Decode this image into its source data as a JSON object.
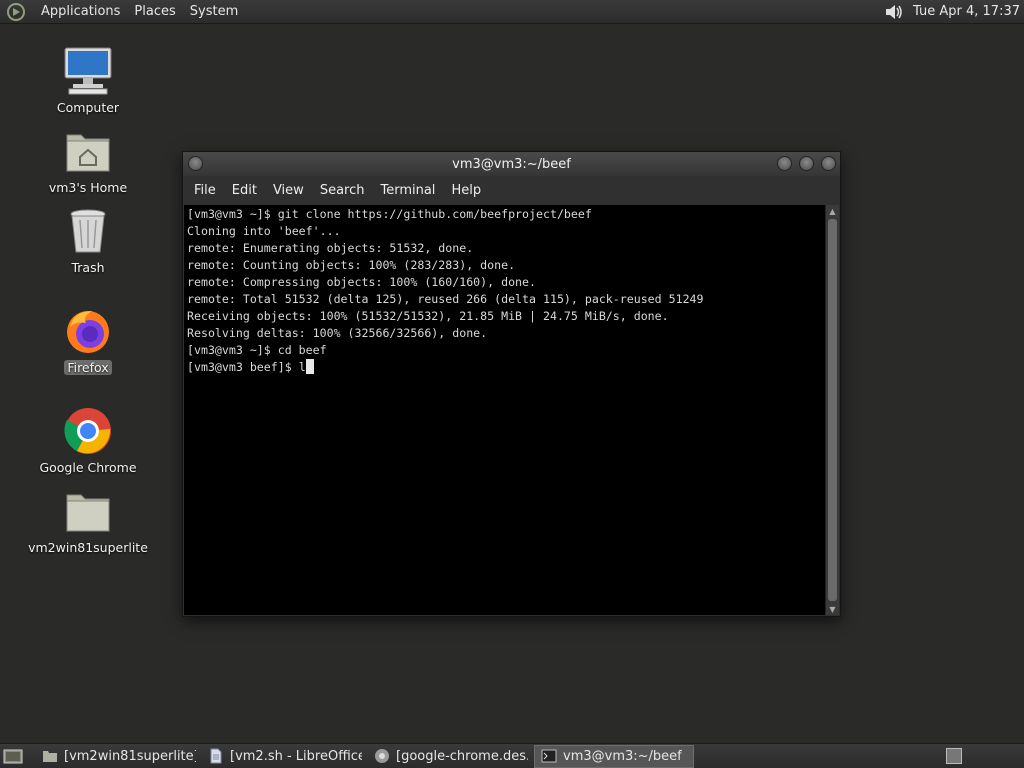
{
  "top_panel": {
    "menus": [
      "Applications",
      "Places",
      "System"
    ],
    "clock": "Tue Apr  4, 17:37"
  },
  "desktop_icons": [
    {
      "label": "Computer",
      "icon": "computer-icon"
    },
    {
      "label": "vm3's Home",
      "icon": "home-folder-icon"
    },
    {
      "label": "Trash",
      "icon": "trash-icon"
    },
    {
      "label": "Firefox",
      "icon": "firefox-icon"
    },
    {
      "label": "Google Chrome",
      "icon": "chrome-icon"
    },
    {
      "label": "vm2win81superlite",
      "icon": "folder-icon"
    }
  ],
  "terminal": {
    "title": "vm3@vm3:~/beef",
    "menus": [
      "File",
      "Edit",
      "View",
      "Search",
      "Terminal",
      "Help"
    ],
    "lines": [
      "[vm3@vm3 ~]$ git clone https://github.com/beefproject/beef",
      "Cloning into 'beef'...",
      "remote: Enumerating objects: 51532, done.",
      "remote: Counting objects: 100% (283/283), done.",
      "remote: Compressing objects: 100% (160/160), done.",
      "remote: Total 51532 (delta 125), reused 266 (delta 115), pack-reused 51249",
      "Receiving objects: 100% (51532/51532), 21.85 MiB | 24.75 MiB/s, done.",
      "Resolving deltas: 100% (32566/32566), done.",
      "[vm3@vm3 ~]$ cd beef"
    ],
    "prompt": "[vm3@vm3 beef]$ ",
    "input": "l"
  },
  "taskbar": {
    "tasks": [
      {
        "label": "[vm2win81superlite]",
        "icon": "folder-icon"
      },
      {
        "label": "[vm2.sh - LibreOffice...",
        "icon": "document-icon"
      },
      {
        "label": "[google-chrome.des...",
        "icon": "chrome-icon"
      },
      {
        "label": "vm3@vm3:~/beef",
        "icon": "terminal-icon"
      }
    ]
  }
}
